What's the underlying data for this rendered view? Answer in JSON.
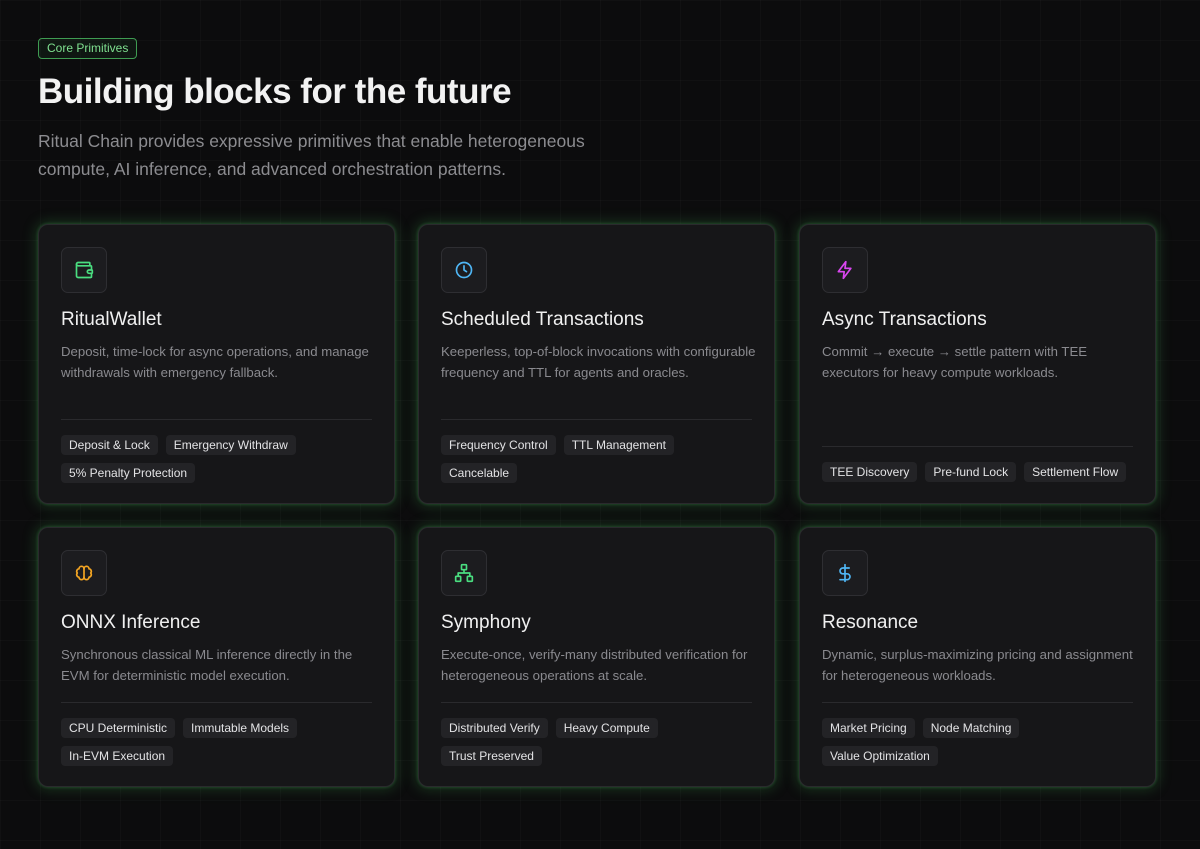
{
  "header": {
    "badge": "Core Primitives",
    "title": "Building blocks for the future",
    "subtitle": "Ritual Chain provides expressive primitives that enable heterogeneous compute, AI inference, and advanced orchestration patterns."
  },
  "cards": [
    {
      "icon": "wallet-icon",
      "icon_color": "#4ade80",
      "title": "RitualWallet",
      "description": "Deposit, time-lock for async operations, and manage withdrawals with emergency fallback.",
      "tags": [
        "Deposit & Lock",
        "Emergency Withdraw",
        "5% Penalty Protection"
      ]
    },
    {
      "icon": "clock-icon",
      "icon_color": "#4fb6f5",
      "title": "Scheduled Transactions",
      "description": "Keeperless, top-of-block invocations with configurable frequency and TTL for agents and oracles.",
      "tags": [
        "Frequency Control",
        "TTL Management",
        "Cancelable"
      ]
    },
    {
      "icon": "lightning-icon",
      "icon_color": "#d946ef",
      "title": "Async Transactions",
      "description": "Commit → execute → settle pattern with TEE executors for heavy compute workloads.",
      "tags": [
        "TEE Discovery",
        "Pre-fund Lock",
        "Settlement Flow"
      ]
    },
    {
      "icon": "brain-icon",
      "icon_color": "#f5a623",
      "title": "ONNX Inference",
      "description": "Synchronous classical ML inference directly in the EVM for deterministic model execution.",
      "tags": [
        "CPU Deterministic",
        "Immutable Models",
        "In-EVM Execution"
      ]
    },
    {
      "icon": "network-icon",
      "icon_color": "#4ade80",
      "title": "Symphony",
      "description": "Execute-once, verify-many distributed verification for heterogeneous operations at scale.",
      "tags": [
        "Distributed Verify",
        "Heavy Compute",
        "Trust Preserved"
      ]
    },
    {
      "icon": "dollar-icon",
      "icon_color": "#4fb6f5",
      "title": "Resonance",
      "description": "Dynamic, surplus-maximizing pricing and assignment for heterogeneous workloads.",
      "tags": [
        "Market Pricing",
        "Node Matching",
        "Value Optimization"
      ]
    }
  ]
}
